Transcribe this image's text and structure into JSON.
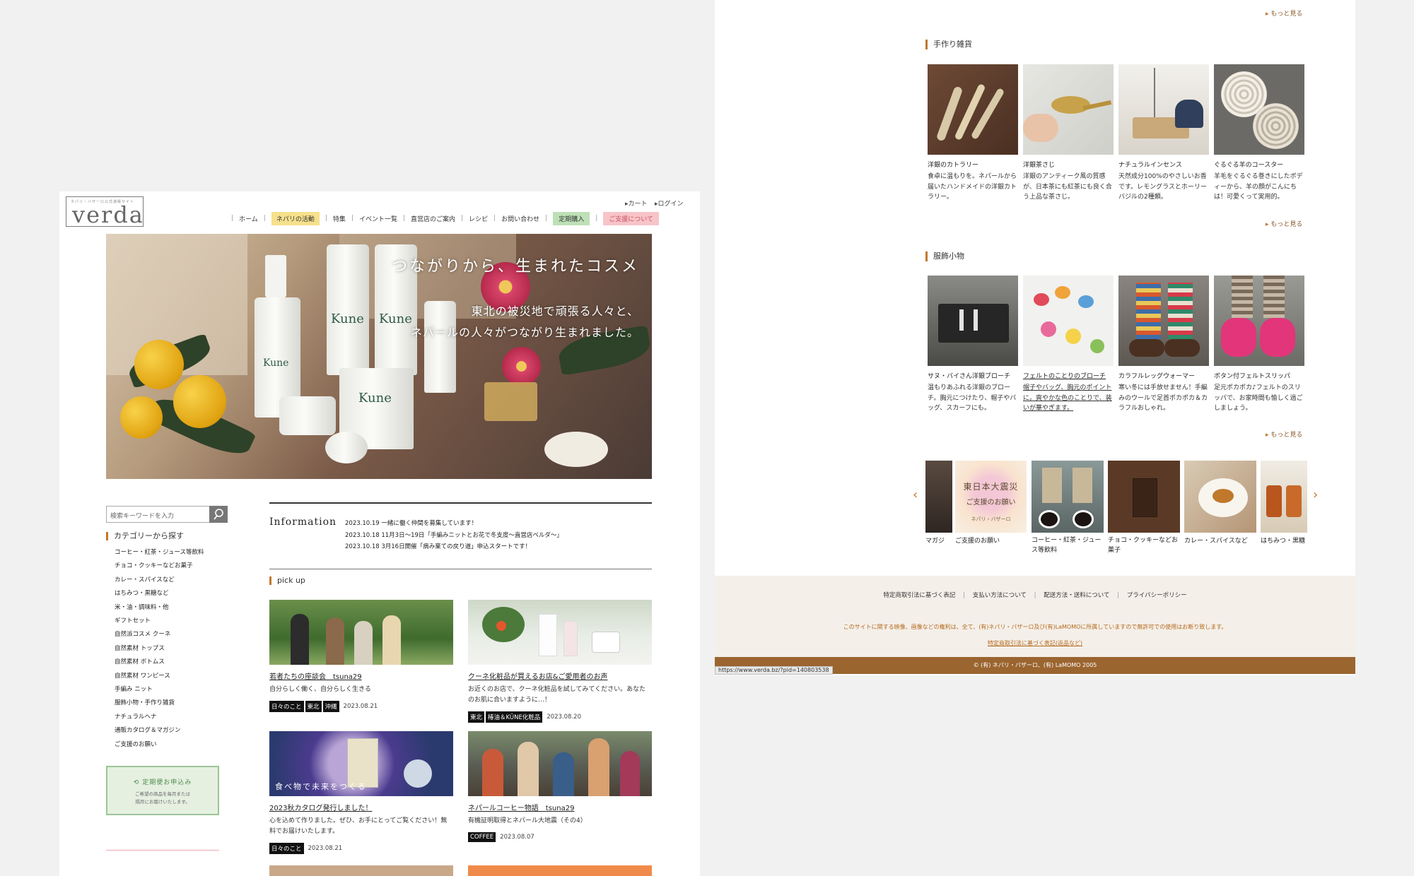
{
  "header": {
    "logo_tagline": "ネパリ・バザーロ公式通販サイト",
    "logo_text": "verda",
    "cart": "カート",
    "login": "ログイン",
    "nav": [
      "ホーム",
      "ネパリの活動",
      "特集",
      "イベント一覧",
      "直営店のご案内",
      "レシピ",
      "お問い合わせ",
      "定期購入",
      "ご支援について"
    ]
  },
  "hero": {
    "title": "つながりから、生まれたコスメ",
    "subtitle_line1": "東北の被災地で頑張る人々と、",
    "subtitle_line2": "ネパールの人々がつながり生まれました。",
    "product_label": "Kune"
  },
  "search": {
    "placeholder": "検索キーワードを入力"
  },
  "categories": {
    "heading": "カテゴリーから探す",
    "items": [
      "コーヒー・紅茶・ジュース等飲料",
      "チョコ・クッキーなどお菓子",
      "カレー・スパイスなど",
      "はちみつ・黒糖など",
      "米・油・調味料・他",
      "ギフトセット",
      "自然派コスメ クーネ",
      "自然素材 トップス",
      "自然素材 ボトムス",
      "自然素材 ワンピース",
      "手編み ニット",
      "服飾小物・手作り雑貨",
      "ナチュラルヘナ",
      "通販カタログ＆マガジン",
      "ご支援のお願い"
    ]
  },
  "teiki": {
    "title": "定期便お申込み",
    "desc_line1": "ご希望の商品を毎月または",
    "desc_line2": "隔月にお届けいたします。"
  },
  "information": {
    "heading": "Information",
    "items": [
      "2023.10.19 一緒に働く仲間を募集しています！",
      "2023.10.18 11月3日〜19日「手編みニットとお花で冬支度〜直営店ベルダ〜」",
      "2023.10.18 3月16日開催「病み棄ての戻り道」申込スタートです！"
    ]
  },
  "pickup": {
    "heading": "pick up",
    "cards": [
      {
        "title": "若者たちの座談会　tsuna29",
        "excerpt": "自分らしく働く、自分らしく生きる",
        "tags": [
          "日々のこと",
          "東北",
          "沖縄"
        ],
        "date": "2023.08.21"
      },
      {
        "title": "クーネ化粧品が買えるお店&ご愛用者のお声",
        "excerpt": "お近くのお店で、クーネ化粧品を試してみてください。あなたのお肌に合いますように…！",
        "tags": [
          "東北",
          "椿油＆KÜNE化粧品"
        ],
        "date": "2023.08.20"
      },
      {
        "title": "2023秋カタログ発行しました！",
        "excerpt": "心を込めて作りました。ぜひ、お手にとってご覧ください！無料でお届けいたします。",
        "tags": [
          "日々のこと"
        ],
        "date": "2023.08.21",
        "overlay": "食べ物で未来をつくる"
      },
      {
        "title": "ネパールコーヒー物語　tsuna29",
        "excerpt": "有機証明取得とネパール大地震（その4）",
        "tags": [
          "COFFEE"
        ],
        "date": "2023.08.07"
      }
    ]
  },
  "right": {
    "more": "もっと見る",
    "zakka": {
      "heading": "手作り雑貨",
      "items": [
        {
          "name": "洋銀のカトラリー",
          "desc": "食卓に温もりを。ネパールから届いたハンドメイドの洋銀カトラリー。"
        },
        {
          "name": "洋銀茶さじ",
          "desc": "洋銀のアンティーク風の質感が、日本茶にも紅茶にも良く合う上品な茶さじ。"
        },
        {
          "name": "ナチュラルインセンス",
          "desc": "天然成分100%のやさしいお香です。レモングラスとホーリーバジルの2種類。"
        },
        {
          "name": "ぐるぐる羊のコースター",
          "desc": "羊毛をぐるぐる巻きにしたボディーから、羊の顔がこんにちは！可愛くって実用的。"
        }
      ]
    },
    "komono": {
      "heading": "服飾小物",
      "items": [
        {
          "name": "サヌ・バイさん洋銀ブローチ",
          "desc": "温もりあふれる洋銀のブローチ。胸元につけたり、帽子やバッグ、スカーフにも。"
        },
        {
          "name": "フェルトのことりのブローチ",
          "desc": "帽子やバッグ、胸元のポイントに。爽やかな色のことりで、装いが華やぎます。"
        },
        {
          "name": "カラフルレッグウォーマー",
          "desc": "寒い冬には手放せません！手編みのウールで足首ポカポカ＆カラフルおしゃれ。"
        },
        {
          "name": "ボタン付フェルトスリッパ",
          "desc": "足元ポカポカ♪フェルトのスリッパで、お家時間も愉しく過ごしましょう。"
        }
      ]
    },
    "carousel": {
      "items": [
        "マガジ",
        "ご支援のお願い",
        "コーヒー・紅茶・ジュース等飲料",
        "チョコ・クッキーなどお菓子",
        "カレー・スパイスなど",
        "はちみつ・黒糖"
      ],
      "banner_title_line1": "東日本大震災",
      "banner_title_line2": "ご支援のお願い",
      "banner_sub": "ネパリ・バザーロ"
    },
    "footer": {
      "links": [
        "特定商取引法に基づく表記",
        "支払い方法について",
        "配送方法・送料について",
        "プライバシーポリシー"
      ],
      "copyright_notice": "このサイトに関する映像、画像などの権利は、全て、(有)ネパリ・バザーロ及び(有)LaMOMOに所属していますので無許可での使用はお断り致します。",
      "tokusho": "特定商取引法に基づく表記(返品など)",
      "copy": "© (有) ネパリ・バザーロ、(有) LaMOMO 2005",
      "status_url": "https://www.verda.bz/?pid=140803538"
    }
  }
}
